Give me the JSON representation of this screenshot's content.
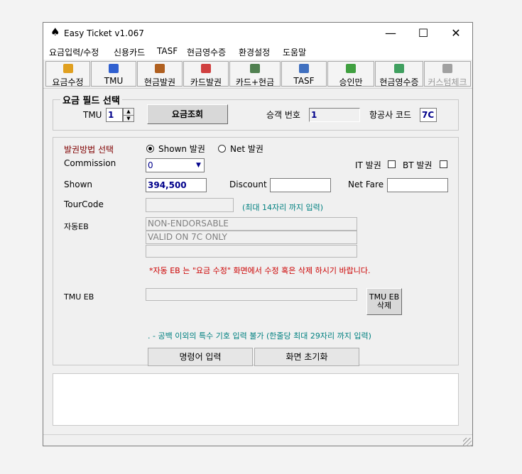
{
  "window": {
    "title": "Easy Ticket v1.067"
  },
  "menu": [
    "요금입력/수정",
    "신용카드",
    "TASF",
    "현금영수증",
    "환경설정",
    "도움말"
  ],
  "toolbar": [
    {
      "label": "요금수정",
      "icon": "edit-icon",
      "color": "#e0a020"
    },
    {
      "label": "TMU",
      "icon": "balls-icon",
      "color": "#3060d0"
    },
    {
      "label": "현금발권",
      "icon": "cash-icon",
      "color": "#b06020"
    },
    {
      "label": "카드발권",
      "icon": "card-icon",
      "color": "#d04040"
    },
    {
      "label": "카드+현금",
      "icon": "cart-icon",
      "color": "#508050"
    },
    {
      "label": "TASF",
      "icon": "calendar-icon",
      "color": "#4070c0"
    },
    {
      "label": "승인만",
      "icon": "approve-icon",
      "color": "#40a040"
    },
    {
      "label": "현금영수증",
      "icon": "money-icon",
      "color": "#40a060"
    },
    {
      "label": "커스텀체크",
      "icon": "printer-icon",
      "color": "#a0a0a0"
    }
  ],
  "fare_field": {
    "legend": "요금 필드 선택",
    "tmu_label": "TMU",
    "tmu_value": "1",
    "lookup_button": "요금조회",
    "pax_label": "승객 번호",
    "pax_value": "1",
    "airline_label": "항공사 코드",
    "airline_value": "7C"
  },
  "issue": {
    "method_label": "발권방법 선택",
    "shown_label": "Shown 발권",
    "net_label": "Net 발권",
    "commission_label": "Commission",
    "commission_value": "0",
    "it_label": "IT 발권",
    "bt_label": "BT 발권",
    "shown_field_label": "Shown",
    "shown_value": "394,500",
    "discount_label": "Discount",
    "discount_value": "",
    "netfare_label": "Net Fare",
    "netfare_value": "",
    "tourcode_label": "TourCode",
    "tourcode_value": "",
    "tourcode_hint": "(최대 14자리 까지 입력)",
    "auto_eb_label": "자동EB",
    "auto_eb_lines": [
      "NON-ENDORSABLE",
      "VALID ON 7C ONLY",
      ""
    ],
    "auto_eb_note": "*자동 EB 는 \"요금 수정\" 화면에서 수정 혹은 삭제 하시기 바랍니다.",
    "tmu_eb_label": "TMU EB",
    "tmu_eb_value": "",
    "tmu_eb_delete_line1": "TMU EB",
    "tmu_eb_delete_line2": "삭제",
    "special_char_note": ". - 공백 이외의  특수 기호 입력 불가 (한줄당 최대 29자리 까지 입력)",
    "command_button": "명령어 입력",
    "reset_button": "화면 초기화"
  },
  "colors": {
    "note_red": "#cc0000",
    "hint_teal": "#008080",
    "label_maroon": "#800000",
    "value_blue": "#00008b"
  }
}
